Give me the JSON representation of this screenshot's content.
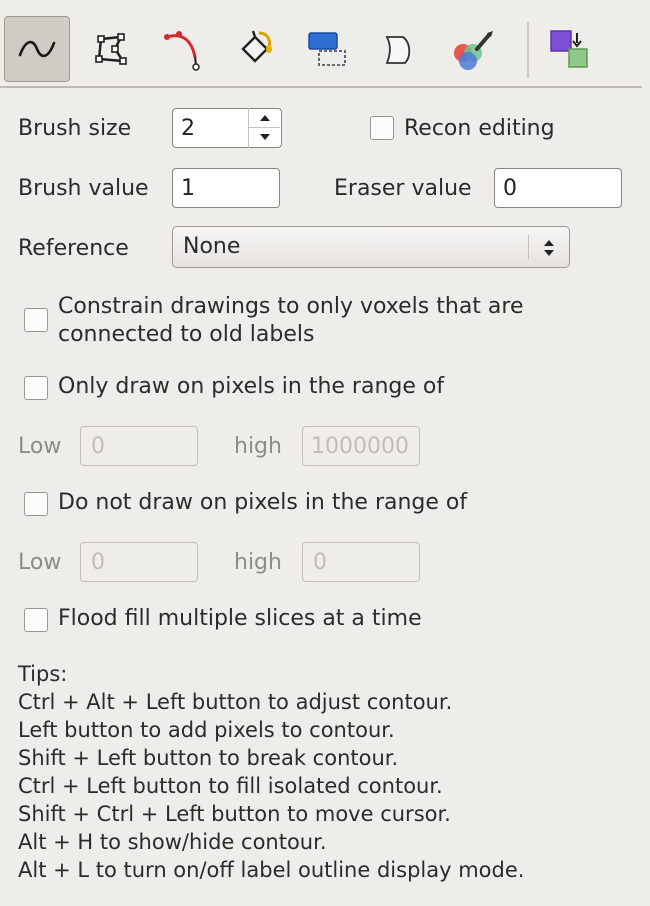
{
  "toolbar": {
    "tools": [
      {
        "icon": "freehand-brush-icon",
        "active": true
      },
      {
        "icon": "polygon-icon",
        "active": false
      },
      {
        "icon": "livewire-icon",
        "active": false
      },
      {
        "icon": "fill-bucket-icon",
        "active": false
      },
      {
        "icon": "region-select-icon",
        "active": false
      },
      {
        "icon": "contour-icon",
        "active": false
      },
      {
        "icon": "color-picker-icon",
        "active": false
      },
      {
        "icon": "recolor-icon",
        "active": false
      }
    ]
  },
  "brush": {
    "size_label": "Brush size",
    "size_value": "2",
    "recon_label": "Recon editing",
    "value_label": "Brush value",
    "value": "1",
    "eraser_label": "Eraser value",
    "eraser_value": "0"
  },
  "reference": {
    "label": "Reference",
    "selected": "None"
  },
  "constrain": {
    "line1": "Constrain drawings to only voxels that are",
    "line2": "connected to old labels"
  },
  "only_draw": {
    "label": "Only draw on pixels in the range of",
    "low_label": "Low",
    "low_value": "0",
    "high_label": "high",
    "high_value": "1000000"
  },
  "no_draw": {
    "label": "Do not draw on pixels in the range of",
    "low_label": "Low",
    "low_value": "0",
    "high_label": "high",
    "high_value": "0"
  },
  "flood": {
    "label": "Flood fill multiple slices at a time"
  },
  "tips": {
    "title": "Tips:",
    "lines": [
      "Ctrl + Alt + Left button to adjust contour.",
      "Left button to add pixels to contour.",
      "Shift + Left button to break contour.",
      "Ctrl + Left button to fill isolated contour.",
      "Shift + Ctrl + Left button to move cursor.",
      "Alt + H to show/hide contour.",
      "Alt + L to turn on/off label outline display mode."
    ]
  }
}
